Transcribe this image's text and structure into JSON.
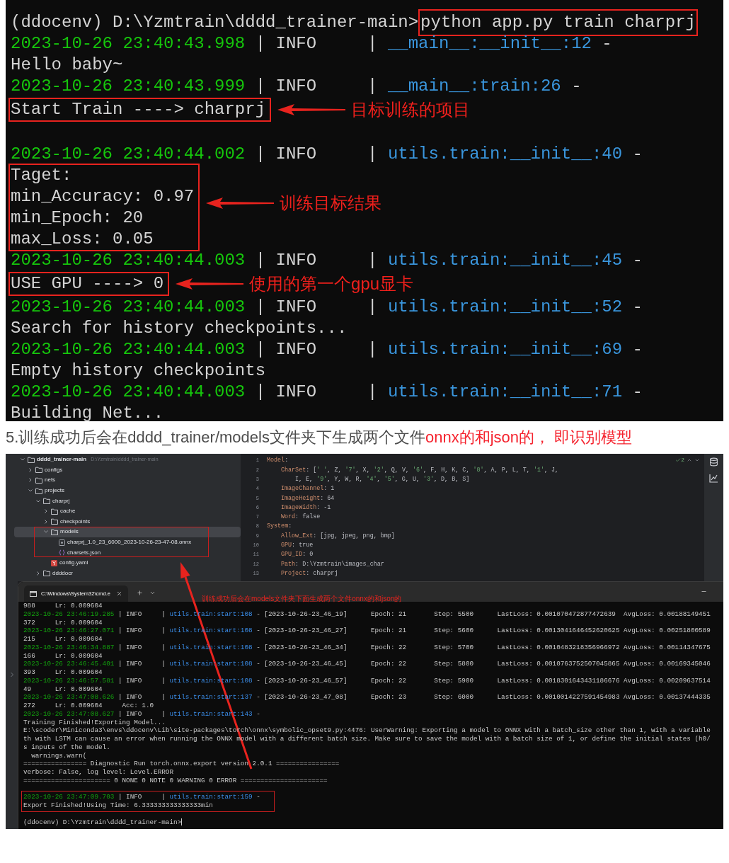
{
  "console": {
    "lines": [
      {
        "kind": "command",
        "prompt": "(ddocenv) D:\\Yzmtrain\\dddd_trainer-main>",
        "command": "python app.py train charprj"
      },
      {
        "kind": "log",
        "timestamp": "2023-10-26 23:40:43.998",
        "level": " | INFO     | ",
        "source": "__main__:__init__:12",
        "rest": " -"
      },
      {
        "kind": "text",
        "text": "Hello baby~"
      },
      {
        "kind": "log",
        "timestamp": "2023-10-26 23:40:43.999",
        "level": " | INFO     | ",
        "source": "__main__:train:26",
        "rest": " -"
      },
      {
        "kind": "group",
        "lines": [
          "Start Train ----> charprj"
        ],
        "note": "目标训练的项目"
      },
      {
        "kind": "blank"
      },
      {
        "kind": "log",
        "timestamp": "2023-10-26 23:40:44.002",
        "level": " | INFO     | ",
        "source": "utils.train:__init__:40",
        "rest": " -"
      },
      {
        "kind": "group",
        "lines": [
          "Taget:",
          "min_Accuracy: 0.97",
          "min_Epoch: 20",
          "max_Loss: 0.05"
        ],
        "note": "训练目标结果"
      },
      {
        "kind": "log",
        "timestamp": "2023-10-26 23:40:44.003",
        "level": " | INFO     | ",
        "source": "utils.train:__init__:45",
        "rest": " -"
      },
      {
        "kind": "group",
        "lines": [
          "USE GPU ----> 0"
        ],
        "note": "使用的第一个gpu显卡"
      },
      {
        "kind": "log",
        "timestamp": "2023-10-26 23:40:44.003",
        "level": " | INFO     | ",
        "source": "utils.train:__init__:52",
        "rest": " -"
      },
      {
        "kind": "text",
        "text": "Search for history checkpoints..."
      },
      {
        "kind": "log",
        "timestamp": "2023-10-26 23:40:44.003",
        "level": " | INFO     | ",
        "source": "utils.train:__init__:69",
        "rest": " -"
      },
      {
        "kind": "text",
        "text": "Empty history checkpoints"
      },
      {
        "kind": "log",
        "timestamp": "2023-10-26 23:40:44.003",
        "level": " | INFO     | ",
        "source": "utils.train:__init__:71",
        "rest": " -"
      },
      {
        "kind": "text",
        "text": "Building Net..."
      }
    ]
  },
  "instruction": {
    "segments": [
      {
        "text": "5.训练成功后会在dddd_trainer/models文件夹下生成两个文件",
        "emphasis": false
      },
      {
        "text": "onnx的和json的， 即识别模型",
        "emphasis": true
      }
    ]
  },
  "ide": {
    "tree": [
      {
        "label": "dddd_trainer-main",
        "hint": "D:\\Yzmtrain\\dddd_trainer-main",
        "kind": "folder",
        "expanded": true,
        "selected": false,
        "children": [
          {
            "label": "configs",
            "kind": "folder",
            "expanded": false,
            "selected": false
          },
          {
            "label": "nets",
            "kind": "folder",
            "expanded": false,
            "selected": false
          },
          {
            "label": "projects",
            "kind": "folder",
            "expanded": true,
            "selected": false,
            "children": [
              {
                "label": "charprj",
                "kind": "folder",
                "expanded": true,
                "selected": false,
                "children": [
                  {
                    "label": "cache",
                    "kind": "folder",
                    "expanded": false,
                    "selected": false
                  },
                  {
                    "label": "checkpoints",
                    "kind": "folder",
                    "expanded": false,
                    "selected": false
                  },
                  {
                    "label": "models",
                    "kind": "folder",
                    "expanded": true,
                    "selected": true,
                    "children": [
                      {
                        "label": "charprj_1.0_23_6000_2023-10-26-23-47-08.onnx",
                        "kind": "onnx",
                        "selected": false
                      },
                      {
                        "label": "charsets.json",
                        "kind": "json",
                        "selected": false
                      }
                    ]
                  },
                  {
                    "label": "config.yaml",
                    "kind": "yaml",
                    "selected": false
                  }
                ]
              },
              {
                "label": "ddddocr",
                "kind": "folder",
                "expanded": false,
                "selected": false
              }
            ]
          }
        ]
      }
    ],
    "editor": {
      "inspection_count": "2",
      "lines": [
        {
          "number": "1",
          "key": "Model",
          "value": ":",
          "children": [
            {
              "number": "2",
              "key": "CharSet",
              "value": ": [' ', Z, '7', X, '2', Q, V, '6', F, H, K, C, '8', A, P, L, T, '1', J,",
              "children": [
                {
                  "number": "3",
                  "value": "I, E, '9', Y, W, R, '4', '5', G, U, '3', D, B, S]"
                }
              ]
            },
            {
              "number": "4",
              "key": "ImageChannel",
              "value": ": 1"
            },
            {
              "number": "5",
              "key": "ImageHeight",
              "value": ": 64"
            },
            {
              "number": "6",
              "key": "ImageWidth",
              "value": ": -1"
            },
            {
              "number": "7",
              "key": "Word",
              "value": ": false"
            }
          ]
        },
        {
          "number": "8",
          "key": "System",
          "value": ":",
          "children": [
            {
              "number": "9",
              "key": "Allow_Ext",
              "value": ": [jpg, jpeg, png, bmp]"
            },
            {
              "number": "10",
              "key": "GPU",
              "value": ": true"
            },
            {
              "number": "11",
              "key": "GPU_ID",
              "value": ": 0"
            },
            {
              "number": "12",
              "key": "Path",
              "value": ": D:\\Yzmtrain\\images_char"
            },
            {
              "number": "13",
              "key": "Project",
              "value": ": charprj"
            }
          ]
        }
      ]
    }
  },
  "terminal": {
    "tab_title": "C:\\Windows\\System32\\cmd.e",
    "caption": "训练成功后会在models文件夹下面生成两个文件onnx的和json的",
    "lines": [
      {
        "kind": "text",
        "text": "988     Lr: 0.009604"
      },
      {
        "kind": "log",
        "timestamp": "2023-10-26 23:46:19.285",
        "level": " | INFO     | ",
        "source": "utils.train:start:108",
        "rest": " - [2023-10-26-23_46_19]      Epoch: 21       Step: 5500      LastLoss: 0.001070472877472639  AvgLoss: 0.00188149451"
      },
      {
        "kind": "text",
        "text": "372     Lr: 0.009604"
      },
      {
        "kind": "log",
        "timestamp": "2023-10-26 23:46:27.071",
        "level": " | INFO     | ",
        "source": "utils.train:start:108",
        "rest": " - [2023-10-26-23_46_27]      Epoch: 21       Step: 5600      LastLoss: 0.0013041646452620625 AvgLoss: 0.00251800589"
      },
      {
        "kind": "text",
        "text": "215     Lr: 0.009604"
      },
      {
        "kind": "log",
        "timestamp": "2023-10-26 23:46:34.887",
        "level": " | INFO     | ",
        "source": "utils.train:start:108",
        "rest": " - [2023-10-26-23_46_34]      Epoch: 22       Step: 5700      LastLoss: 0.0010483218356966972 AvgLoss: 0.00114347675"
      },
      {
        "kind": "text",
        "text": "166     Lr: 0.009604"
      },
      {
        "kind": "log",
        "timestamp": "2023-10-26 23:46:45.401",
        "level": " | INFO     | ",
        "source": "utils.train:start:108",
        "rest": " - [2023-10-26-23_46_45]      Epoch: 22       Step: 5800      LastLoss: 0.0010763752507045865 AvgLoss: 0.00169345046"
      },
      {
        "kind": "text",
        "text": "393     Lr: 0.009604"
      },
      {
        "kind": "log",
        "timestamp": "2023-10-26 23:46:57.581",
        "level": " | INFO     | ",
        "source": "utils.train:start:108",
        "rest": " - [2023-10-26-23_46_57]      Epoch: 22       Step: 5900      LastLoss: 0.0018301643431186676 AvgLoss: 0.00209637514"
      },
      {
        "kind": "text",
        "text": "49      Lr: 0.009604"
      },
      {
        "kind": "log",
        "timestamp": "2023-10-26 23:47:08.626",
        "level": " | INFO     | ",
        "source": "utils.train:start:137",
        "rest": " - [2023-10-26-23_47_08]      Epoch: 23       Step: 6000      LastLoss: 0.0010014227591454983 AvgLoss: 0.00137444335"
      },
      {
        "kind": "text",
        "text": "272     Lr: 0.009604     Acc: 1.0"
      },
      {
        "kind": "log",
        "timestamp": "2023-10-26 23:47:08.627",
        "level": " | INFO     | ",
        "source": "utils.train:start:143",
        "rest": " -"
      },
      {
        "kind": "text",
        "text": "Training Finished!Exporting Model..."
      },
      {
        "kind": "text",
        "text": "E:\\scoder\\Miniconda3\\envs\\ddocenv\\Lib\\site-packages\\torch\\onnx\\symbolic_opset9.py:4476: UserWarning: Exporting a model to ONNX with a batch_size other than 1, with a variable"
      },
      {
        "kind": "text",
        "text": "th with LSTM can cause an error when running the ONNX model with a different batch size. Make sure to save the model with a batch size of 1, or define the initial states (h0/"
      },
      {
        "kind": "text",
        "text": "s inputs of the model."
      },
      {
        "kind": "text",
        "text": "  warnings.warn("
      },
      {
        "kind": "text",
        "text": "================ Diagnostic Run torch.onnx.export version 2.0.1 ================"
      },
      {
        "kind": "text",
        "text": "verbose: False, log level: Level.ERROR"
      },
      {
        "kind": "text",
        "text": "====================== 0 NONE 0 NOTE 0 WARNING 0 ERROR ======================"
      },
      {
        "kind": "blank"
      },
      {
        "kind": "group",
        "lines": [
          {
            "kind": "log",
            "timestamp": "2023-10-26 23:47:09.703",
            "level": " | INFO     | ",
            "source": "utils.train:start:159",
            "rest": " -"
          },
          {
            "kind": "text",
            "text": "Export Finished!Using Time: 6.333333333333333min"
          }
        ]
      },
      {
        "kind": "blank"
      },
      {
        "kind": "prompt",
        "text": "(ddocenv) D:\\Yzmtrain\\dddd_trainer-main>"
      }
    ]
  }
}
